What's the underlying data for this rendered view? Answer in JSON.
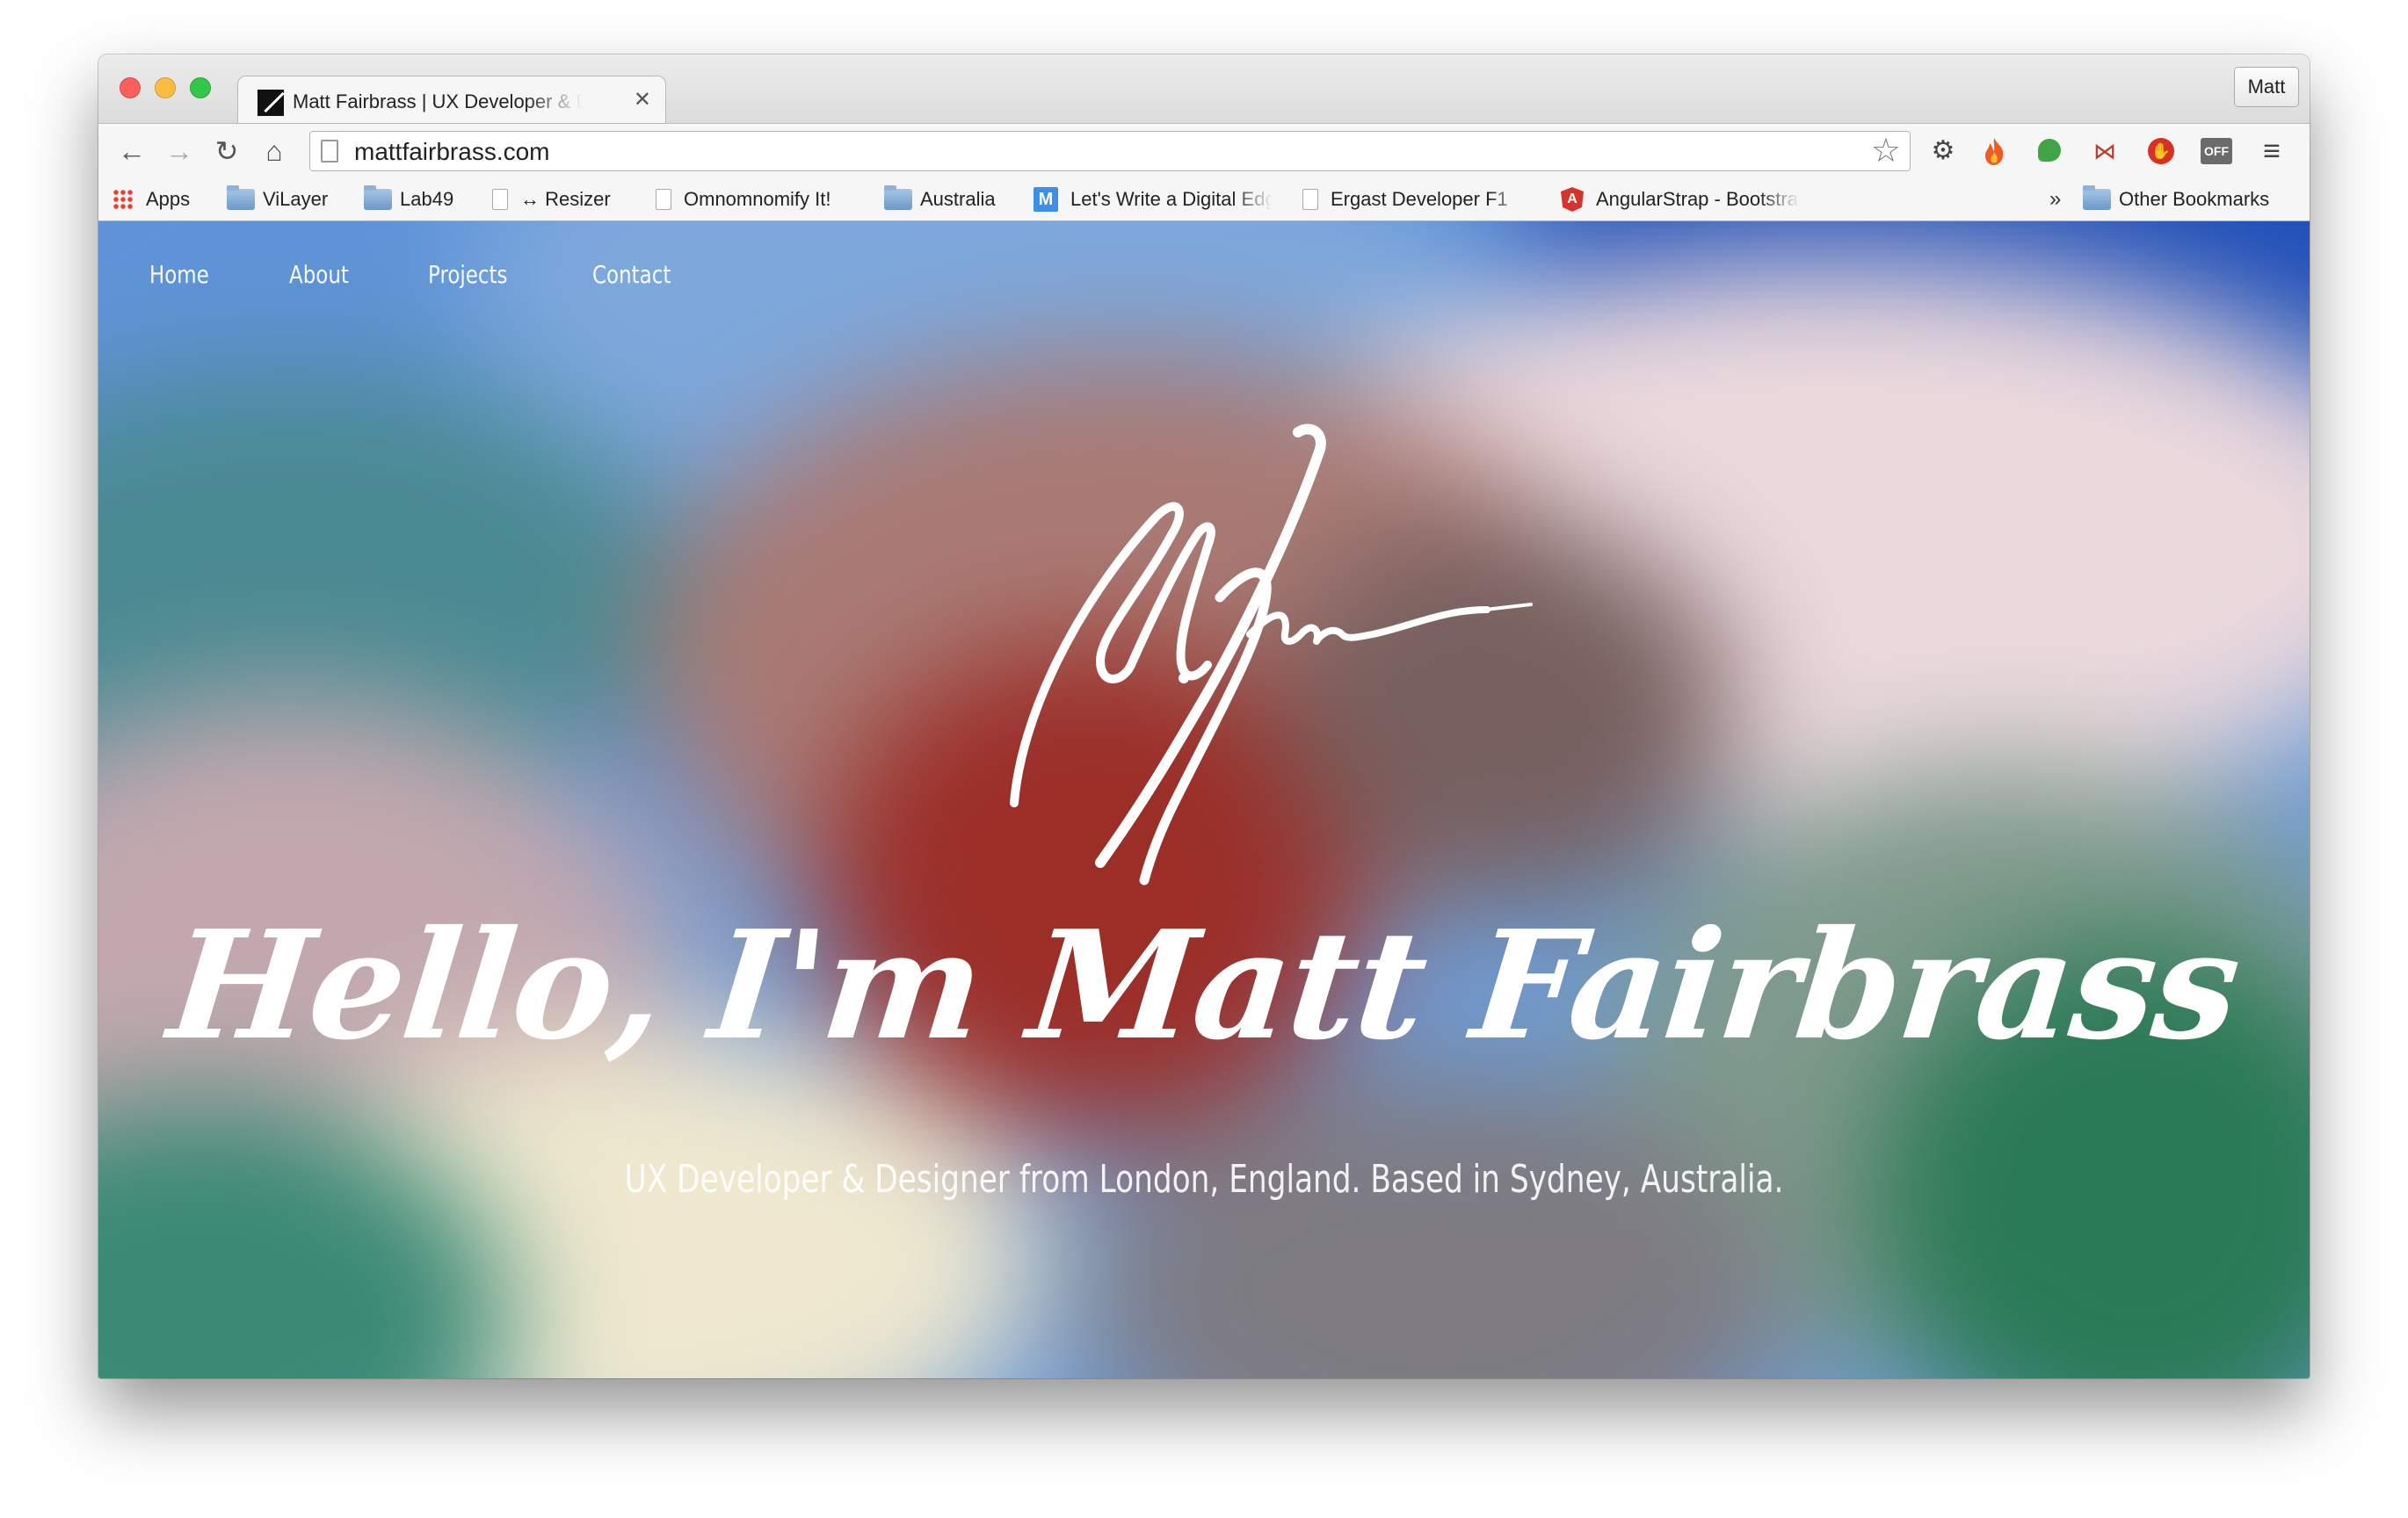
{
  "tab": {
    "title": "Matt Fairbrass | UX Developer & Designer",
    "close_label": "✕"
  },
  "profile": {
    "label": "Matt"
  },
  "toolbar": {
    "url": "mattfairbrass.com",
    "back_icon": "←",
    "forward_icon": "→",
    "reload_icon": "↻",
    "home_icon": "⌂",
    "star_icon": "☆"
  },
  "extensions": [
    {
      "name": "settings-gear-icon",
      "glyph": "⚙"
    },
    {
      "name": "fire-extension-icon",
      "glyph": "🔥"
    },
    {
      "name": "leaf-extension-icon",
      "glyph": ""
    },
    {
      "name": "nodes-extension-icon",
      "glyph": "⋈"
    },
    {
      "name": "stop-hand-extension-icon",
      "glyph": "✋"
    },
    {
      "name": "off-toggle-extension-icon",
      "glyph": "OFF"
    },
    {
      "name": "chrome-menu-icon",
      "glyph": "≡"
    }
  ],
  "bookmarks": {
    "apps": "Apps",
    "vilayer": "ViLayer",
    "lab49": "Lab49",
    "resizer": "↔ Resizer",
    "omnomnomify": "Omnomnomify It!",
    "australia": "Australia",
    "lets_write": "Let's Write a Digital Edge",
    "ergast": "Ergast Developer F1",
    "angularstrap": "AngularStrap - Bootstrap",
    "more": "»",
    "other": "Other Bookmarks"
  },
  "site": {
    "nav": [
      "Home",
      "About",
      "Projects",
      "Contact"
    ],
    "heading": "Hello, I'm Matt Fairbrass",
    "subheading": "UX Developer & Designer from London, England. Based in Sydney, Australia."
  },
  "colors": {
    "sky_blue": "#5a8fd6",
    "deep_blue": "#1f4fb8",
    "teal": "#3d7f86",
    "red": "#9c2e28",
    "green": "#2a7a55",
    "cream": "#efe8cf",
    "pink": "#e7d5d8"
  }
}
